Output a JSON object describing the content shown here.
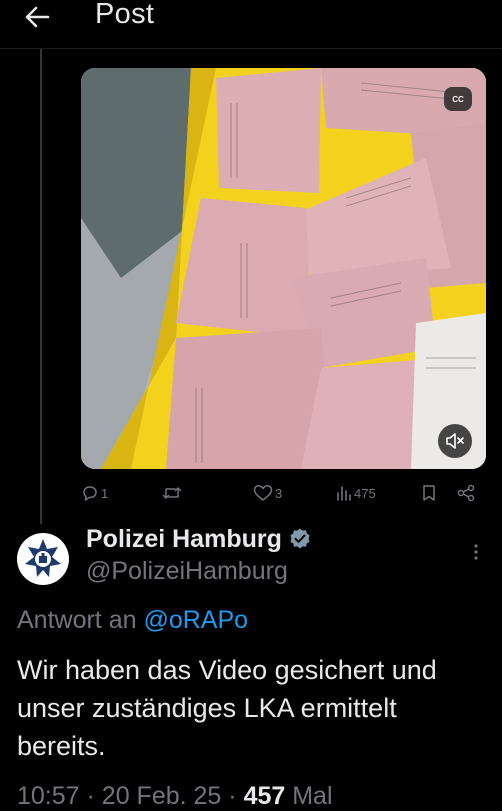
{
  "header": {
    "title": "Post"
  },
  "media": {
    "cc_label": "CC"
  },
  "actions": {
    "replies": "1",
    "reposts": "",
    "likes": "3",
    "views": "475"
  },
  "post": {
    "display_name": "Polizei Hamburg",
    "handle": "@PolizeiHamburg",
    "reply_prefix": "Antwort an",
    "reply_mention": "@oRAPo",
    "text": "Wir haben das Video gesichert und unser zuständiges LKA ermittelt bereits.",
    "time": "10:57",
    "date": "20 Feb. 25",
    "view_count": "457",
    "view_suffix": "Mal"
  },
  "colors": {
    "background": "#000000",
    "text": "#e7e9ea",
    "secondary": "#71767b",
    "link": "#1d9bf0",
    "verified": "#829aab"
  }
}
